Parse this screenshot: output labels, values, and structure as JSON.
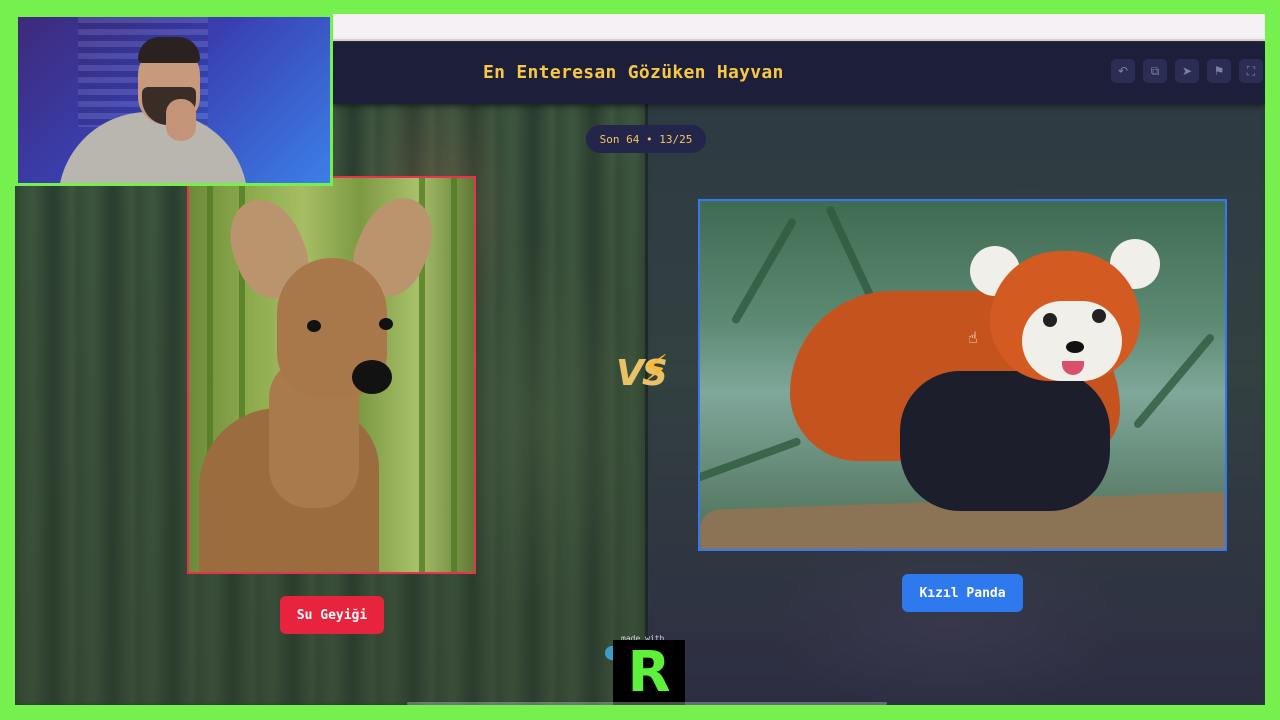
{
  "header": {
    "title": "En Enteresan Gözüken Hayvan",
    "icons": [
      "undo-icon",
      "copy-icon",
      "share-icon",
      "flag-icon",
      "fullscreen-icon"
    ],
    "icon_glyphs": [
      "↶",
      "⧉",
      "➤",
      "⚑",
      "⛶"
    ]
  },
  "round": {
    "label": "Son 64 • 13/25"
  },
  "left_option": {
    "name": "Su Geyiği",
    "color": "#e8233e"
  },
  "right_option": {
    "name": "Kızıl Panda",
    "color": "#2f79ee"
  },
  "vs": {
    "text": "VS",
    "bolt": "⚡"
  },
  "branding": {
    "made_with": "made with",
    "logo_letter": "R"
  }
}
